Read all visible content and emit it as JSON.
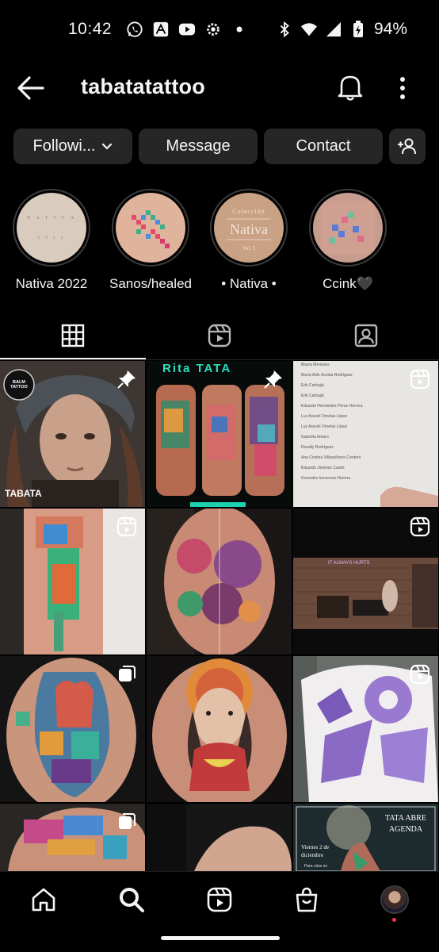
{
  "status_bar": {
    "time": "10:42",
    "battery": "94%",
    "icons": [
      "whatsapp-icon",
      "acrobat-icon",
      "youtube-icon",
      "settings-icon",
      "dot-icon",
      "bluetooth-icon",
      "wifi-icon",
      "signal-icon",
      "battery-icon"
    ]
  },
  "header": {
    "username": "tabatatattoo",
    "back_icon": "back-arrow-icon",
    "notifications_icon": "bell-icon",
    "more_icon": "more-vertical-icon"
  },
  "actions": {
    "following_label": "Followi...",
    "message_label": "Message",
    "contact_label": "Contact",
    "add_user_icon": "add-user-icon"
  },
  "highlights": [
    {
      "label": "Nativa 2022",
      "cover_text": "NATIVA 2022"
    },
    {
      "label": "Sanos/healed",
      "cover_text": ""
    },
    {
      "label": "• Nativa •",
      "cover_text_top": "Colección",
      "cover_text_main": "Nativa",
      "cover_text_bottom": "Vol. 1"
    },
    {
      "label": "Ccink🖤",
      "cover_text": ""
    }
  ],
  "tabs": [
    {
      "name": "grid",
      "icon": "grid-icon",
      "active": true
    },
    {
      "name": "reels",
      "icon": "reels-icon",
      "active": false
    },
    {
      "name": "tagged",
      "icon": "tagged-icon",
      "active": false
    }
  ],
  "posts": {
    "p1": {
      "logo_text": "BALM TATTOO",
      "caption": "TABATA",
      "badge": "pin-icon"
    },
    "p2": {
      "top_text": "Rita TATA",
      "badge": "pin-icon"
    },
    "p3": {
      "badge": "reel-icon",
      "list": [
        "Mayra Meneses",
        "María Aide Acosta Rodríguez",
        "Erik Carbajal",
        "Erik Carbajal",
        "Eduardo Hernández Pérez Herrera",
        "Luz Araceli Ornelas López",
        "Luz Araceli Ornelas López",
        "Gabriela Amaro",
        "Rosally Rodríguez",
        "Ana Cristina Villaseñores Cordero",
        "Eduardo Jiménez Castel",
        "Gonzalez Inocencia Herrera"
      ]
    },
    "p4": {
      "badge": "reel-icon"
    },
    "p5": {
      "badge": ""
    },
    "p6": {
      "badge": "reel-icon",
      "sign_text": "IT ALWAYS HURTS"
    },
    "p7": {
      "badge": "carousel-icon"
    },
    "p8": {
      "badge": ""
    },
    "p9": {
      "badge": "reel-icon"
    },
    "p10": {
      "badge": "carousel-icon"
    },
    "p11": {
      "badge": ""
    },
    "p12": {
      "title": "TATA ABRE AGENDA",
      "date": "Viernes 2 de diciembre",
      "sub": "Para citas en"
    }
  },
  "bottom_nav": [
    {
      "name": "home",
      "icon": "home-icon"
    },
    {
      "name": "search",
      "icon": "search-icon"
    },
    {
      "name": "reels",
      "icon": "reels-icon"
    },
    {
      "name": "shop",
      "icon": "shop-icon"
    },
    {
      "name": "profile",
      "icon": "profile-avatar"
    }
  ],
  "colors": {
    "background": "#000000",
    "button": "#262626",
    "text": "#f5f5f5",
    "notification": "#ff3040"
  }
}
